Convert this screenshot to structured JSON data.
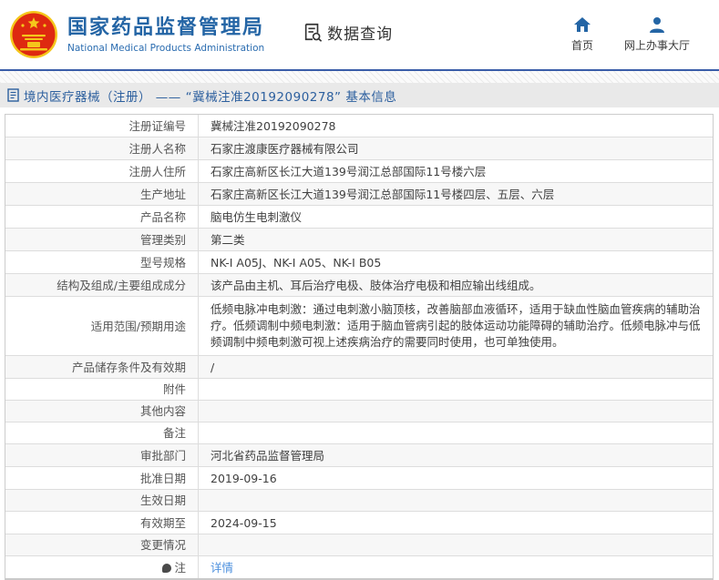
{
  "header": {
    "org_name_zh": "国家药品监督管理局",
    "org_name_en": "National Medical Products Administration",
    "query_label": "数据查询",
    "nav": [
      {
        "label": "首页",
        "icon": "home-icon"
      },
      {
        "label": "网上办事大厅",
        "icon": "user-icon"
      }
    ]
  },
  "title_bar": {
    "text": "境内医疗器械（注册） —— “冀械注准20192090278” 基本信息"
  },
  "table": {
    "rows": [
      {
        "label": "注册证编号",
        "value": "冀械注准20192090278"
      },
      {
        "label": "注册人名称",
        "value": "石家庄渡康医疗器械有限公司"
      },
      {
        "label": "注册人住所",
        "value": "石家庄高新区长江大道139号润江总部国际11号楼六层"
      },
      {
        "label": "生产地址",
        "value": "石家庄高新区长江大道139号润江总部国际11号楼四层、五层、六层"
      },
      {
        "label": "产品名称",
        "value": "脑电仿生电刺激仪"
      },
      {
        "label": "管理类别",
        "value": "第二类"
      },
      {
        "label": "型号规格",
        "value": "NK-I A05J、NK-I A05、NK-I B05"
      },
      {
        "label": "结构及组成/主要组成成分",
        "value": "该产品由主机、耳后治疗电极、肢体治疗电极和相应输出线组成。"
      },
      {
        "label": "适用范围/预期用途",
        "value": "低频电脉冲电刺激：通过电刺激小脑顶核，改善脑部血液循环，适用于缺血性脑血管疾病的辅助治疗。低频调制中频电刺激：适用于脑血管病引起的肢体运动功能障碍的辅助治疗。低频电脉冲与低频调制中频电刺激可视上述疾病治疗的需要同时使用，也可单独使用。",
        "tall": true
      },
      {
        "label": "产品储存条件及有效期",
        "value": "/"
      },
      {
        "label": "附件",
        "value": ""
      },
      {
        "label": "其他内容",
        "value": ""
      },
      {
        "label": "备注",
        "value": ""
      },
      {
        "label": "审批部门",
        "value": "河北省药品监督管理局"
      },
      {
        "label": "批准日期",
        "value": "2019-09-16"
      },
      {
        "label": "生效日期",
        "value": ""
      },
      {
        "label": "有效期至",
        "value": "2024-09-15"
      },
      {
        "label": "变更情况",
        "value": ""
      },
      {
        "label": "注",
        "value": "详情",
        "link": true,
        "label_icon": "note-icon"
      }
    ]
  },
  "colors": {
    "brand_blue": "#2465a5",
    "title_blue": "#2c5f9e",
    "link_blue": "#4b8fde",
    "emblem_red": "#de2910",
    "emblem_gold": "#f5c61b",
    "rule_blue": "#3a5da8",
    "alt_row_bg": "#f7f7f7"
  }
}
